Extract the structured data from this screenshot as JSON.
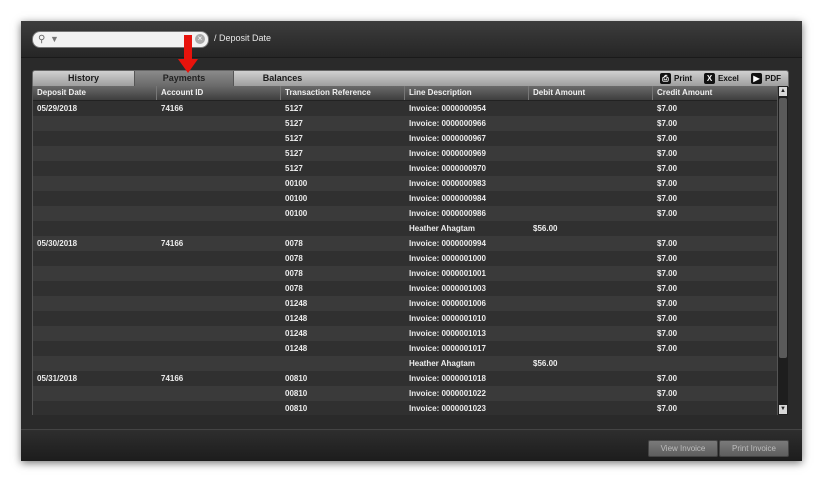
{
  "search": {
    "placeholder": ""
  },
  "breadcrumb": "/ Deposit Date",
  "tabs": [
    "History",
    "Payments",
    "Balances"
  ],
  "active_tab": "Payments",
  "export": {
    "print": "Print",
    "excel": "Excel",
    "pdf": "PDF"
  },
  "columns": [
    "Deposit Date",
    "Account ID",
    "Transaction Reference",
    "Line Description",
    "Debit Amount",
    "Credit Amount"
  ],
  "rows": [
    [
      "05/29/2018",
      "74166",
      "5127",
      "Invoice: 0000000954",
      "",
      "$7.00"
    ],
    [
      "",
      "",
      "5127",
      "Invoice: 0000000966",
      "",
      "$7.00"
    ],
    [
      "",
      "",
      "5127",
      "Invoice: 0000000967",
      "",
      "$7.00"
    ],
    [
      "",
      "",
      "5127",
      "Invoice: 0000000969",
      "",
      "$7.00"
    ],
    [
      "",
      "",
      "5127",
      "Invoice: 0000000970",
      "",
      "$7.00"
    ],
    [
      "",
      "",
      "00100",
      "Invoice: 0000000983",
      "",
      "$7.00"
    ],
    [
      "",
      "",
      "00100",
      "Invoice: 0000000984",
      "",
      "$7.00"
    ],
    [
      "",
      "",
      "00100",
      "Invoice: 0000000986",
      "",
      "$7.00"
    ],
    [
      "",
      "",
      "",
      "Heather Ahagtam",
      "$56.00",
      ""
    ],
    [
      "05/30/2018",
      "74166",
      "0078",
      "Invoice: 0000000994",
      "",
      "$7.00"
    ],
    [
      "",
      "",
      "0078",
      "Invoice: 0000001000",
      "",
      "$7.00"
    ],
    [
      "",
      "",
      "0078",
      "Invoice: 0000001001",
      "",
      "$7.00"
    ],
    [
      "",
      "",
      "0078",
      "Invoice: 0000001003",
      "",
      "$7.00"
    ],
    [
      "",
      "",
      "01248",
      "Invoice: 0000001006",
      "",
      "$7.00"
    ],
    [
      "",
      "",
      "01248",
      "Invoice: 0000001010",
      "",
      "$7.00"
    ],
    [
      "",
      "",
      "01248",
      "Invoice: 0000001013",
      "",
      "$7.00"
    ],
    [
      "",
      "",
      "01248",
      "Invoice: 0000001017",
      "",
      "$7.00"
    ],
    [
      "",
      "",
      "",
      "Heather Ahagtam",
      "$56.00",
      ""
    ],
    [
      "05/31/2018",
      "74166",
      "00810",
      "Invoice: 0000001018",
      "",
      "$7.00"
    ],
    [
      "",
      "",
      "00810",
      "Invoice: 0000001022",
      "",
      "$7.00"
    ],
    [
      "",
      "",
      "00810",
      "Invoice: 0000001023",
      "",
      "$7.00"
    ]
  ],
  "buttons": {
    "view_invoice": "View Invoice",
    "print_invoice": "Print Invoice"
  },
  "colors": {
    "annotation_arrow": "#e8130c"
  }
}
